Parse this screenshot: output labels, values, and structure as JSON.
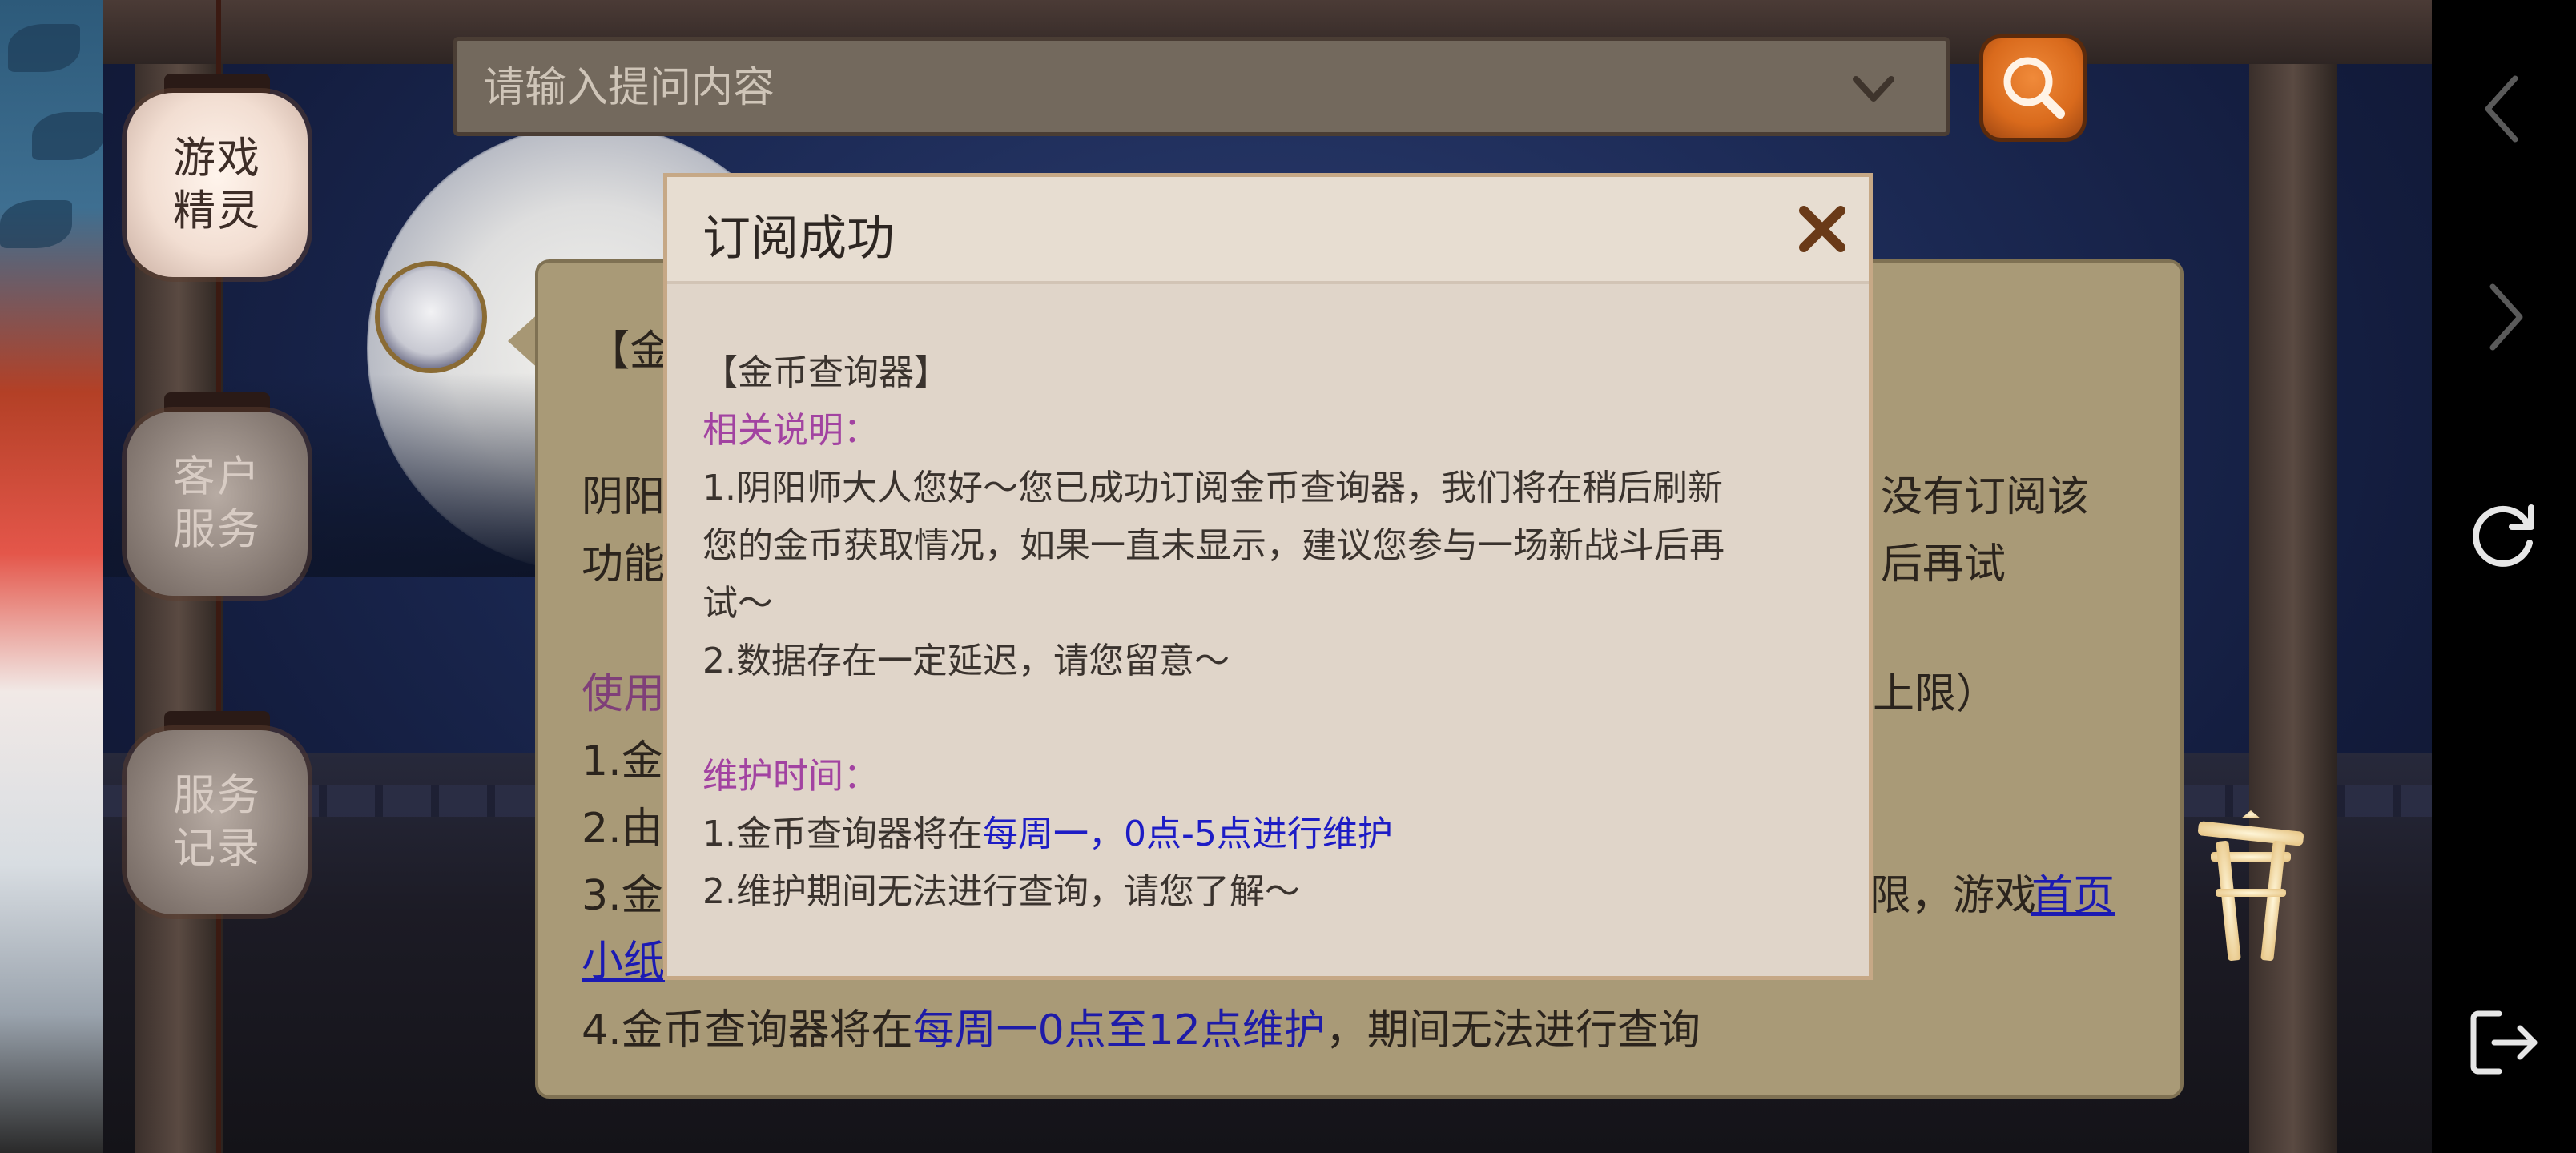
{
  "search": {
    "placeholder": "请输入提问内容"
  },
  "side_menu": {
    "items": [
      {
        "label_line1": "游戏",
        "label_line2": "精灵"
      },
      {
        "label_line1": "客户",
        "label_line2": "服务"
      },
      {
        "label_line1": "服务",
        "label_line2": "记录"
      }
    ]
  },
  "card": {
    "line1": "【金",
    "line2_left": "阴阳",
    "line2_right": "没有订阅该",
    "line3_left": "功能",
    "line3_right": "后再试",
    "section_left": "使用",
    "section_right": "上限）",
    "item1": "1.金",
    "item2": "2.由",
    "item3_left": "3.金",
    "item3_right": "限，游戏",
    "item3_link": "首页",
    "item3_link2": "小纸",
    "item4_pre": "4.金币查询器将在",
    "item4_blue": "每周一0点至12点维护",
    "item4_post": "，期间无法进行查询"
  },
  "modal": {
    "title": "订阅成功",
    "subject": "【金币查询器】",
    "section1_title": "相关说明：",
    "line1": "1.阴阳师大人您好～您已成功订阅金币查询器，我们将在稍后刷新",
    "line2": "您的金币获取情况，如果一直未显示，建议您参与一场新战斗后再",
    "line3": "试～",
    "line4": "2.数据存在一定延迟，请您留意～",
    "section2_title": "维护时间：",
    "m1_pre": "1.金币查询器将在",
    "m1_blue1": "每周一",
    "m1_sep": "，",
    "m1_blue2": "0点-5点进行维护",
    "m2": "2.维护期间无法进行查询，请您了解～"
  },
  "icons": {
    "search": "search-icon",
    "close": "close-icon",
    "chevron": "chevron-down-icon",
    "torii": "torii-icon",
    "back": "back-icon",
    "forward": "forward-icon",
    "refresh": "refresh-icon",
    "exit": "exit-icon"
  },
  "colors": {
    "accent_orange": "#d96a1c",
    "link_blue": "#1d1cc5",
    "section_magenta": "#a243a1"
  }
}
